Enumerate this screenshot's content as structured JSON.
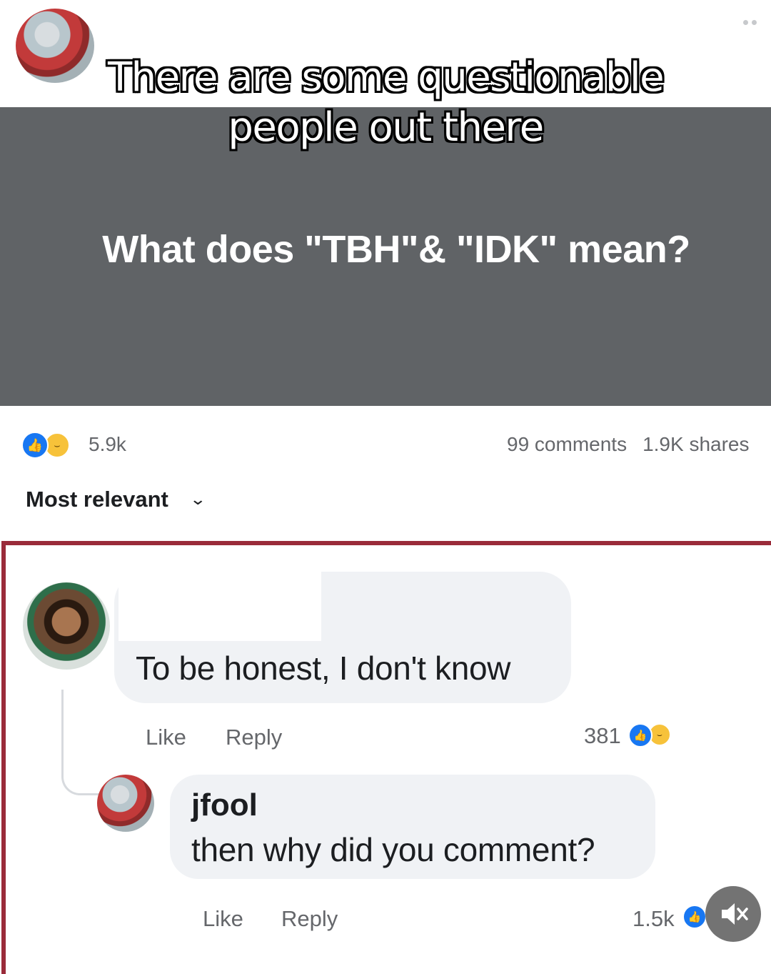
{
  "overlay": {
    "caption_line1": "There are some questionable",
    "caption_line2": "people out there"
  },
  "post": {
    "question": "What does \"TBH\"& \"IDK\" mean?",
    "reaction_count": "5.9k",
    "comments_count": "99 comments",
    "shares_count": "1.9K shares"
  },
  "sort": {
    "label": "Most relevant"
  },
  "comment": {
    "text": "To be honest, I don't know",
    "like_label": "Like",
    "reply_label": "Reply",
    "reaction_count": "381"
  },
  "reply": {
    "author": "jfool",
    "text": "then why did you comment?",
    "like_label": "Like",
    "reply_label": "Reply",
    "reaction_count": "1.5k"
  },
  "colors": {
    "question_panel": "#606366",
    "highlight_border": "#9a2b3a",
    "like_blue": "#1877f2"
  },
  "icons": [
    "more-dots-icon",
    "like-reaction-icon",
    "haha-reaction-icon",
    "chevron-down-icon",
    "muted-speaker-icon"
  ]
}
